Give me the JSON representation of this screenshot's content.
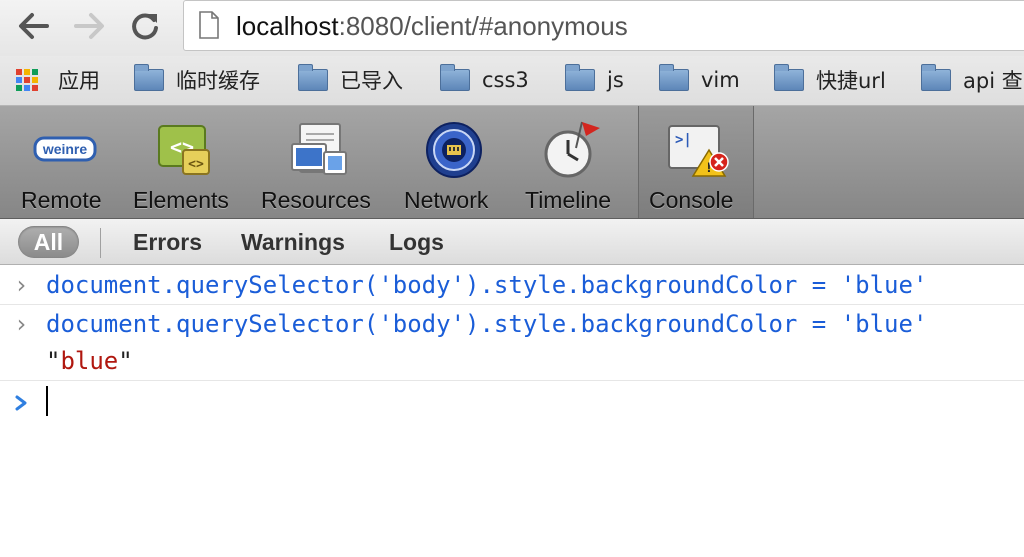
{
  "browser": {
    "url": {
      "host": "localhost",
      "rest": ":8080/client/#anonymous"
    },
    "nav": {
      "back_icon": "back-arrow-icon",
      "forward_icon": "forward-arrow-icon",
      "reload_icon": "reload-icon"
    }
  },
  "bookmarks": {
    "apps_label": "应用",
    "items": [
      {
        "label": "临时缓存"
      },
      {
        "label": "已导入"
      },
      {
        "label": "css3"
      },
      {
        "label": "js"
      },
      {
        "label": "vim"
      },
      {
        "label": "快捷url"
      },
      {
        "label": "api 查"
      }
    ]
  },
  "toolbar": {
    "tools": [
      {
        "label": "Remote",
        "icon": "weinre-logo-icon",
        "logo_text": "weinre"
      },
      {
        "label": "Elements",
        "icon": "elements-icon"
      },
      {
        "label": "Resources",
        "icon": "resources-icon"
      },
      {
        "label": "Network",
        "icon": "network-icon"
      },
      {
        "label": "Timeline",
        "icon": "timeline-icon"
      },
      {
        "label": "Console",
        "icon": "console-icon",
        "selected": true
      }
    ]
  },
  "filters": {
    "all": "All",
    "errors": "Errors",
    "warnings": "Warnings",
    "logs": "Logs"
  },
  "console": {
    "prompt_glyph": "›",
    "entries": [
      {
        "command": "document.querySelector('body').style.backgroundColor = 'blue'"
      },
      {
        "command": "document.querySelector('body').style.backgroundColor = 'blue'",
        "result": "blue",
        "result_quote": "\""
      }
    ]
  },
  "colors": {
    "command": "#1a5dd8",
    "result": "#b0170f",
    "toolbar": "#959595"
  }
}
